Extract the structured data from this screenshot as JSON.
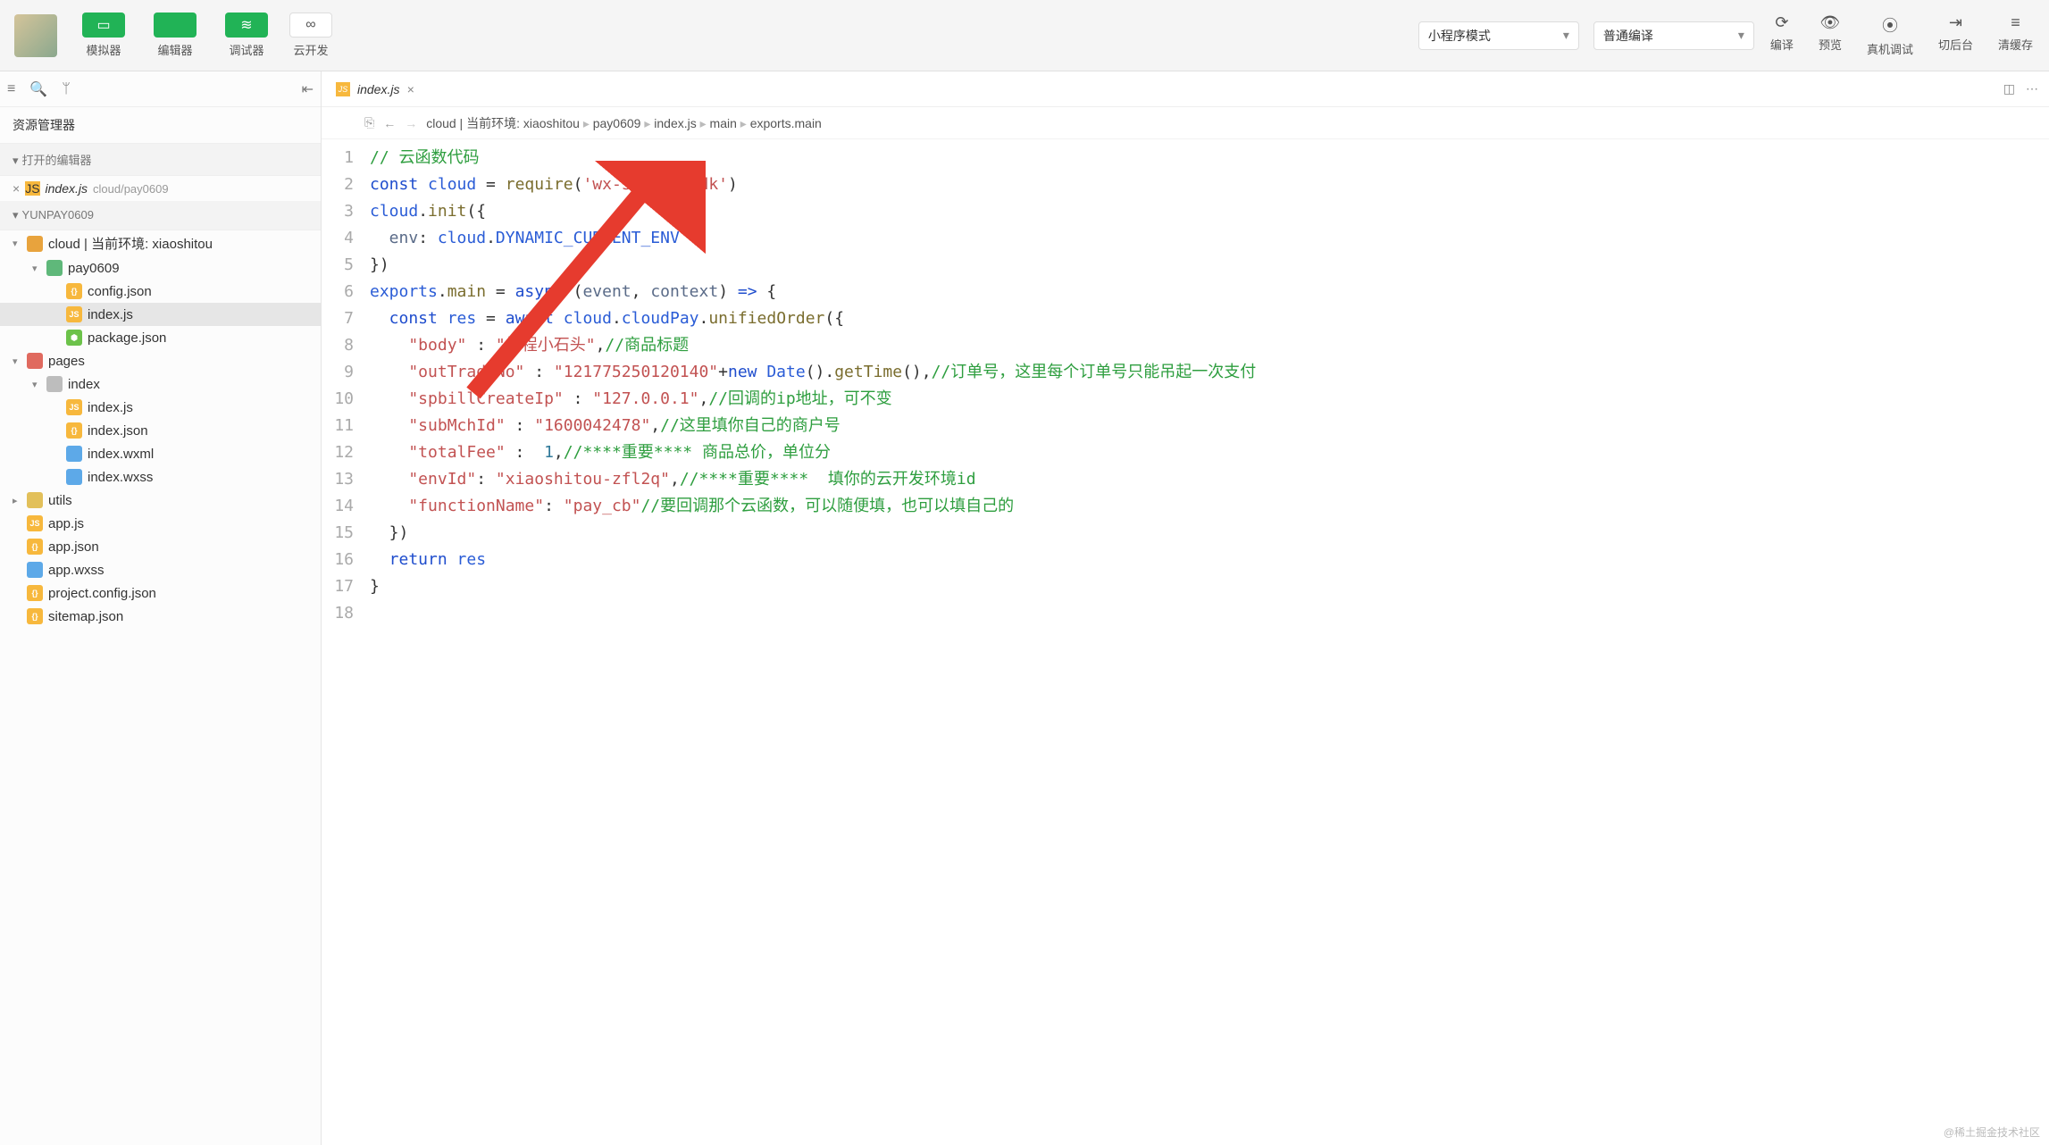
{
  "toolbar": {
    "buttons": [
      {
        "label": "模拟器",
        "sym": "▭"
      },
      {
        "label": "编辑器",
        "sym": "</>"
      },
      {
        "label": "调试器",
        "sym": "≋"
      }
    ],
    "cloud": {
      "label": "云开发",
      "sym": "∞"
    },
    "select_mode": "小程序模式",
    "select_compile": "普通编译",
    "actions": [
      {
        "label": "编译",
        "sym": "⟳"
      },
      {
        "label": "预览",
        "sym": "👁"
      },
      {
        "label": "真机调试",
        "sym": "⦿"
      },
      {
        "label": "切后台",
        "sym": "⇥"
      },
      {
        "label": "清缓存",
        "sym": "≡"
      }
    ]
  },
  "sidebar": {
    "title": "资源管理器",
    "open_section": "打开的编辑器",
    "open_item": {
      "name": "index.js",
      "path": "cloud/pay0609"
    },
    "project": "YUNPAY0609",
    "tree": [
      {
        "d": 0,
        "chev": "▾",
        "icon": "fi-folder",
        "label": "cloud | 当前环境: xiaoshitou"
      },
      {
        "d": 1,
        "chev": "▾",
        "icon": "fi-folder-green",
        "label": "pay0609"
      },
      {
        "d": 2,
        "chev": "",
        "icon": "fi-json",
        "label": "config.json"
      },
      {
        "d": 2,
        "chev": "",
        "icon": "fi-js",
        "label": "index.js",
        "selected": true
      },
      {
        "d": 2,
        "chev": "",
        "icon": "fi-node",
        "label": "package.json"
      },
      {
        "d": 0,
        "chev": "▾",
        "icon": "fi-folder-red",
        "label": "pages"
      },
      {
        "d": 1,
        "chev": "▾",
        "icon": "fi-folder-grey",
        "label": "index"
      },
      {
        "d": 2,
        "chev": "",
        "icon": "fi-js",
        "label": "index.js"
      },
      {
        "d": 2,
        "chev": "",
        "icon": "fi-json",
        "label": "index.json"
      },
      {
        "d": 2,
        "chev": "",
        "icon": "fi-wxml",
        "label": "index.wxml"
      },
      {
        "d": 2,
        "chev": "",
        "icon": "fi-wxss",
        "label": "index.wxss"
      },
      {
        "d": 0,
        "chev": "▸",
        "icon": "fi-folder-yellow",
        "label": "utils"
      },
      {
        "d": 0,
        "chev": "",
        "icon": "fi-js",
        "label": "app.js"
      },
      {
        "d": 0,
        "chev": "",
        "icon": "fi-json",
        "label": "app.json"
      },
      {
        "d": 0,
        "chev": "",
        "icon": "fi-wxss",
        "label": "app.wxss"
      },
      {
        "d": 0,
        "chev": "",
        "icon": "fi-json",
        "label": "project.config.json"
      },
      {
        "d": 0,
        "chev": "",
        "icon": "fi-json",
        "label": "sitemap.json"
      }
    ]
  },
  "editor": {
    "tab": {
      "name": "index.js"
    },
    "breadcrumb": [
      "cloud | 当前环境: xiaoshitou",
      "pay0609",
      "index.js",
      "main",
      "exports.main"
    ],
    "lines": [
      {
        "n": 1,
        "tokens": [
          {
            "t": "// 云函数代码",
            "c": "c-com"
          }
        ]
      },
      {
        "n": 2,
        "tokens": [
          {
            "t": "const ",
            "c": "c-kw"
          },
          {
            "t": "cloud",
            "c": "c-id"
          },
          {
            "t": " = ",
            "c": ""
          },
          {
            "t": "require",
            "c": "c-fn"
          },
          {
            "t": "(",
            "c": ""
          },
          {
            "t": "'wx-server-sdk'",
            "c": "c-str"
          },
          {
            "t": ")",
            "c": ""
          }
        ]
      },
      {
        "n": 3,
        "tokens": [
          {
            "t": "cloud",
            "c": "c-id"
          },
          {
            "t": ".",
            "c": ""
          },
          {
            "t": "init",
            "c": "c-fn"
          },
          {
            "t": "({",
            "c": ""
          }
        ]
      },
      {
        "n": 4,
        "tokens": [
          {
            "t": "  env",
            "c": "c-prop"
          },
          {
            "t": ": ",
            "c": ""
          },
          {
            "t": "cloud",
            "c": "c-id"
          },
          {
            "t": ".",
            "c": ""
          },
          {
            "t": "DYNAMIC_CURRENT_ENV",
            "c": "c-id"
          }
        ]
      },
      {
        "n": 5,
        "tokens": [
          {
            "t": "})",
            "c": ""
          }
        ]
      },
      {
        "n": 6,
        "tokens": [
          {
            "t": "exports",
            "c": "c-id"
          },
          {
            "t": ".",
            "c": ""
          },
          {
            "t": "main",
            "c": "c-fn"
          },
          {
            "t": " = ",
            "c": ""
          },
          {
            "t": "async",
            "c": "c-kw"
          },
          {
            "t": " (",
            "c": ""
          },
          {
            "t": "event",
            "c": "c-prop"
          },
          {
            "t": ", ",
            "c": ""
          },
          {
            "t": "context",
            "c": "c-prop"
          },
          {
            "t": ") ",
            "c": ""
          },
          {
            "t": "=>",
            "c": "c-kw"
          },
          {
            "t": " {",
            "c": ""
          }
        ]
      },
      {
        "n": 7,
        "tokens": [
          {
            "t": "  const ",
            "c": "c-kw"
          },
          {
            "t": "res",
            "c": "c-id"
          },
          {
            "t": " = ",
            "c": ""
          },
          {
            "t": "await ",
            "c": "c-kw"
          },
          {
            "t": "cloud",
            "c": "c-id"
          },
          {
            "t": ".",
            "c": ""
          },
          {
            "t": "cloudPay",
            "c": "c-id"
          },
          {
            "t": ".",
            "c": ""
          },
          {
            "t": "unifiedOrder",
            "c": "c-fn"
          },
          {
            "t": "({",
            "c": ""
          }
        ]
      },
      {
        "n": 8,
        "tokens": [
          {
            "t": "    \"body\"",
            "c": "c-str"
          },
          {
            "t": " : ",
            "c": ""
          },
          {
            "t": "\"编程小石头\"",
            "c": "c-str"
          },
          {
            "t": ",",
            "c": ""
          },
          {
            "t": "//商品标题",
            "c": "c-com"
          }
        ]
      },
      {
        "n": 9,
        "tokens": [
          {
            "t": "    \"outTradeNo\"",
            "c": "c-str"
          },
          {
            "t": " : ",
            "c": ""
          },
          {
            "t": "\"121775250120140\"",
            "c": "c-str"
          },
          {
            "t": "+",
            "c": ""
          },
          {
            "t": "new ",
            "c": "c-kw"
          },
          {
            "t": "Date",
            "c": "c-id"
          },
          {
            "t": "().",
            "c": ""
          },
          {
            "t": "getTime",
            "c": "c-fn"
          },
          {
            "t": "(),",
            "c": ""
          },
          {
            "t": "//订单号，这里每个订单号只能吊起一次支付",
            "c": "c-com"
          }
        ]
      },
      {
        "n": 10,
        "tokens": [
          {
            "t": "    \"spbillCreateIp\"",
            "c": "c-str"
          },
          {
            "t": " : ",
            "c": ""
          },
          {
            "t": "\"127.0.0.1\"",
            "c": "c-str"
          },
          {
            "t": ",",
            "c": ""
          },
          {
            "t": "//回调的ip地址，可不变",
            "c": "c-com"
          }
        ]
      },
      {
        "n": 11,
        "tokens": [
          {
            "t": "    \"subMchId\"",
            "c": "c-str"
          },
          {
            "t": " : ",
            "c": ""
          },
          {
            "t": "\"1600042478\"",
            "c": "c-str"
          },
          {
            "t": ",",
            "c": ""
          },
          {
            "t": "//这里填你自己的商户号",
            "c": "c-com"
          }
        ]
      },
      {
        "n": 12,
        "tokens": [
          {
            "t": "    \"totalFee\"",
            "c": "c-str"
          },
          {
            "t": " :  ",
            "c": ""
          },
          {
            "t": "1",
            "c": "c-num"
          },
          {
            "t": ",",
            "c": ""
          },
          {
            "t": "//****重要**** 商品总价，单位分",
            "c": "c-com"
          }
        ]
      },
      {
        "n": 13,
        "tokens": [
          {
            "t": "    \"envId\"",
            "c": "c-str"
          },
          {
            "t": ": ",
            "c": ""
          },
          {
            "t": "\"xiaoshitou-zfl2q\"",
            "c": "c-str"
          },
          {
            "t": ",",
            "c": ""
          },
          {
            "t": "//****重要****  填你的云开发环境id",
            "c": "c-com"
          }
        ]
      },
      {
        "n": 14,
        "tokens": [
          {
            "t": "    \"functionName\"",
            "c": "c-str"
          },
          {
            "t": ": ",
            "c": ""
          },
          {
            "t": "\"pay_cb\"",
            "c": "c-str"
          },
          {
            "t": "//要回调那个云函数，可以随便填，也可以填自己的",
            "c": "c-com"
          }
        ]
      },
      {
        "n": 15,
        "tokens": [
          {
            "t": "  })",
            "c": ""
          }
        ]
      },
      {
        "n": 16,
        "tokens": [
          {
            "t": "  return ",
            "c": "c-kw"
          },
          {
            "t": "res",
            "c": "c-id"
          }
        ]
      },
      {
        "n": 17,
        "tokens": [
          {
            "t": "}",
            "c": ""
          }
        ]
      },
      {
        "n": 18,
        "tokens": [
          {
            "t": "",
            "c": ""
          }
        ]
      }
    ]
  },
  "watermark": "@稀土掘金技术社区"
}
